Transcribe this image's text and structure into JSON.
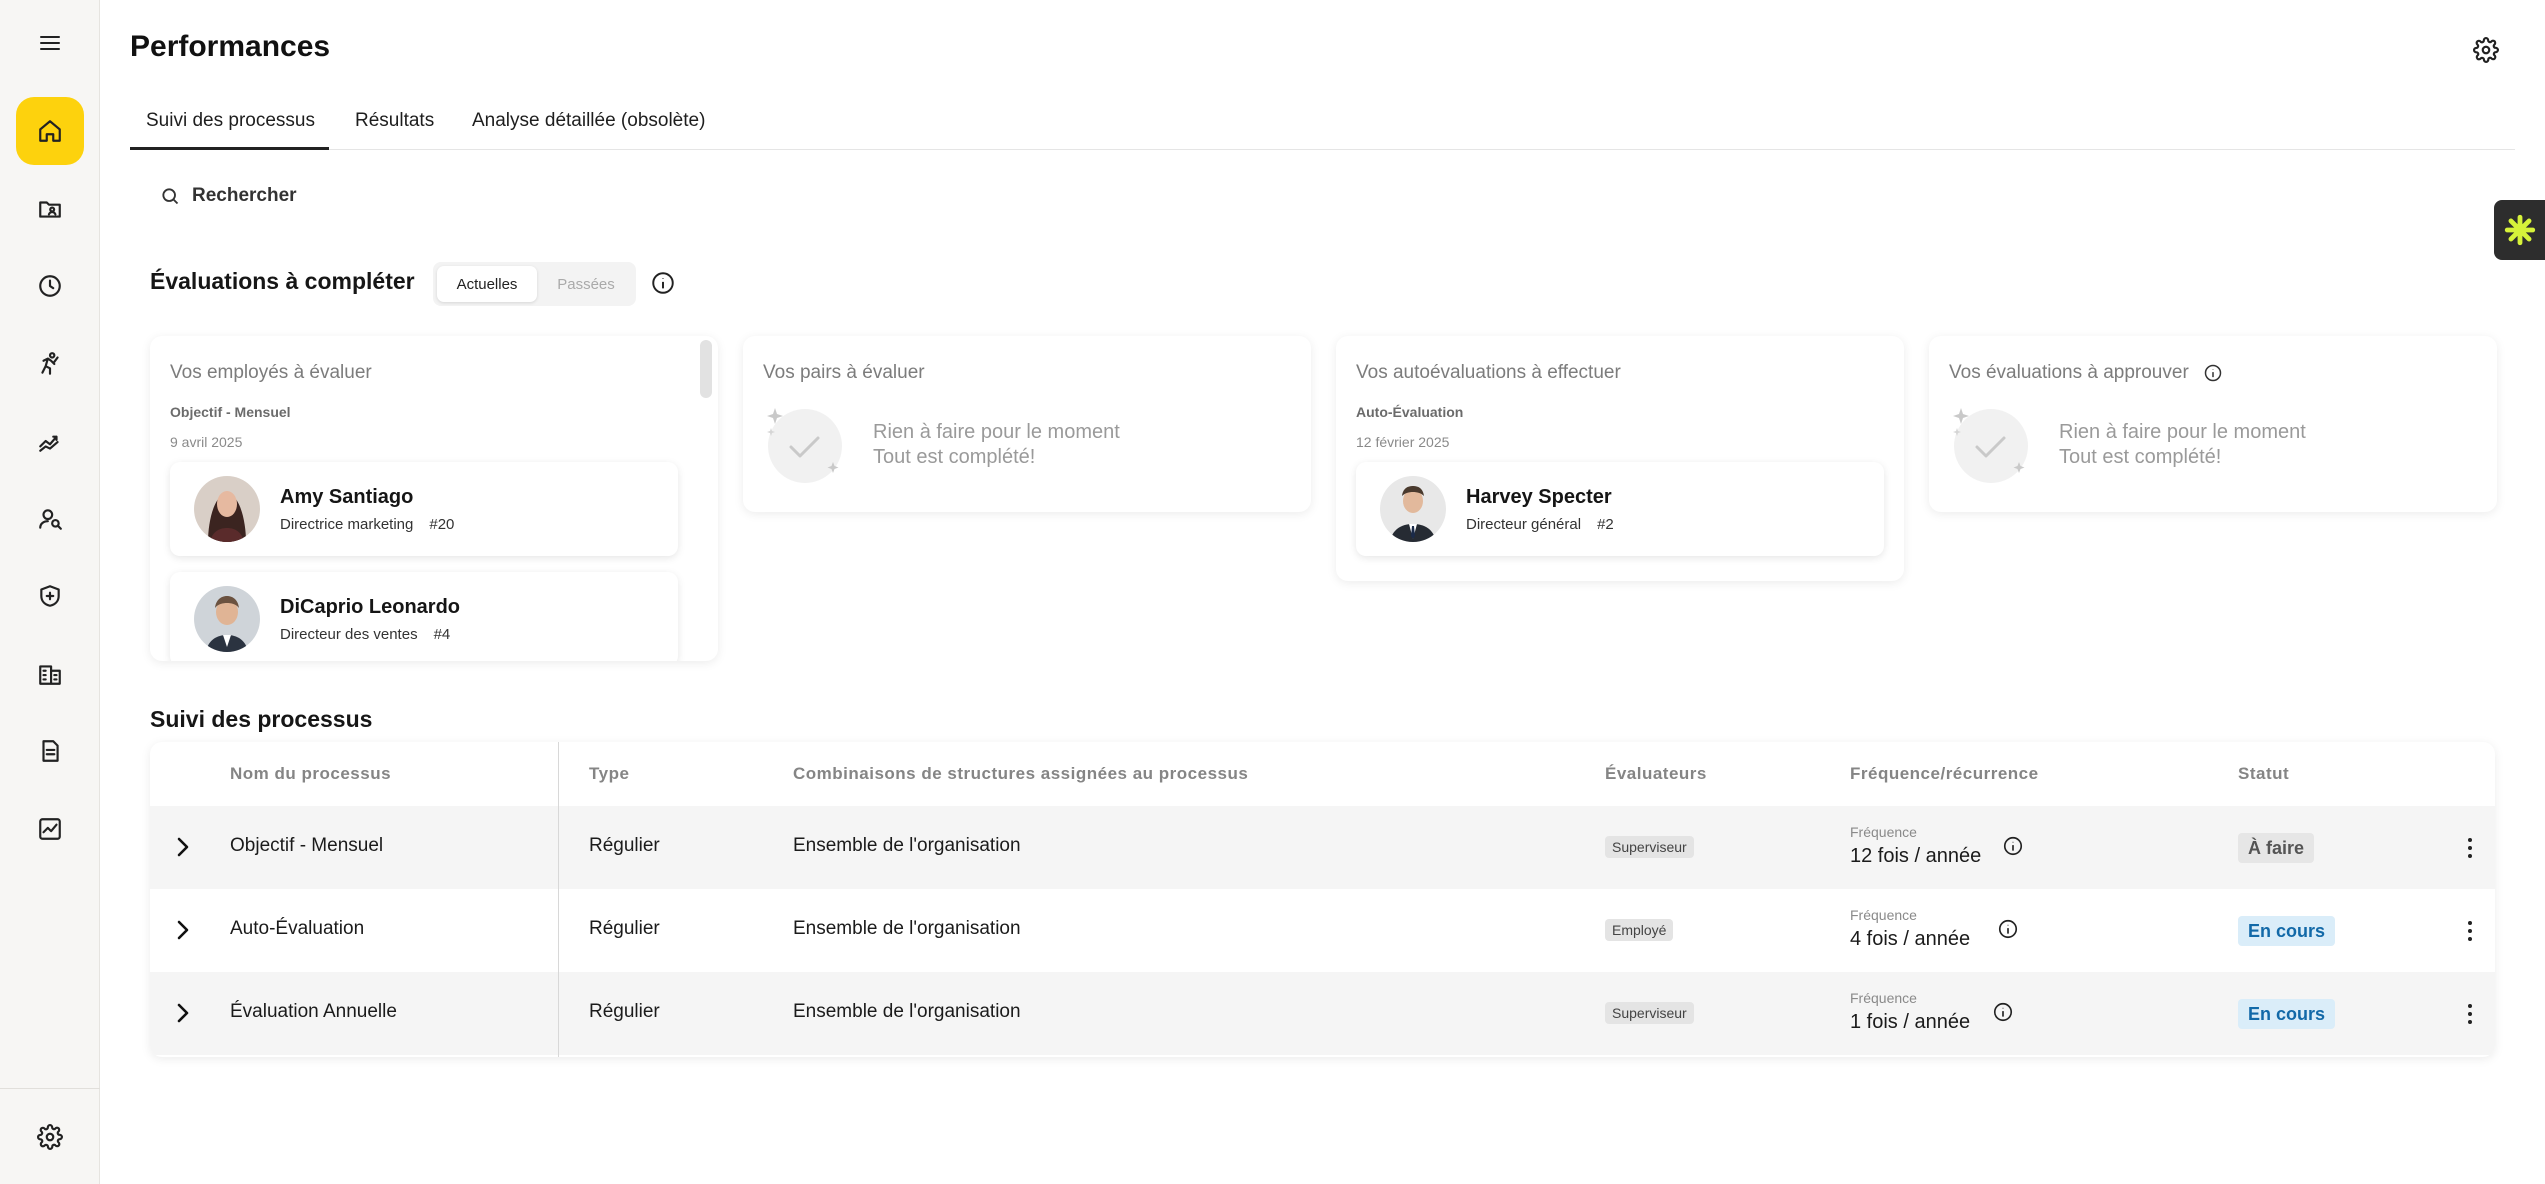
{
  "header": {
    "title": "Performances"
  },
  "tabs": [
    {
      "label": "Suivi des processus",
      "active": true
    },
    {
      "label": "Résultats",
      "active": false
    },
    {
      "label": "Analyse détaillée (obsolète)",
      "active": false
    }
  ],
  "search": {
    "label": "Rechercher"
  },
  "evaluations": {
    "title": "Évaluations à compléter",
    "toggle": {
      "current": "Actuelles",
      "past": "Passées"
    },
    "cards": {
      "employees": {
        "title": "Vos employés à évaluer",
        "process": "Objectif - Mensuel",
        "date": "9 avril 2025",
        "people": [
          {
            "name": "Amy Santiago",
            "role": "Directrice marketing",
            "id": "#20"
          },
          {
            "name": "DiCaprio Leonardo",
            "role": "Directeur des ventes",
            "id": "#4"
          }
        ]
      },
      "peers": {
        "title": "Vos pairs à évaluer",
        "empty_line1": "Rien à faire pour le moment",
        "empty_line2": "Tout est complété!"
      },
      "self": {
        "title": "Vos autoévaluations à effectuer",
        "process": "Auto-Évaluation",
        "date": "12 février 2025",
        "people": [
          {
            "name": "Harvey Specter",
            "role": "Directeur général",
            "id": "#2"
          }
        ]
      },
      "approve": {
        "title": "Vos évaluations à approuver",
        "empty_line1": "Rien à faire pour le moment",
        "empty_line2": "Tout est complété!"
      }
    }
  },
  "process_tracking": {
    "title": "Suivi des processus",
    "columns": {
      "name": "Nom du processus",
      "type": "Type",
      "structures": "Combinaisons de structures assignées au processus",
      "evaluators": "Évaluateurs",
      "frequency": "Fréquence/récurrence",
      "status": "Statut"
    },
    "rows": [
      {
        "name": "Objectif - Mensuel",
        "type": "Régulier",
        "structures": "Ensemble de l'organisation",
        "evaluator": "Superviseur",
        "freq_label": "Fréquence",
        "freq_value": "12 fois / année",
        "status": "À faire"
      },
      {
        "name": "Auto-Évaluation",
        "type": "Régulier",
        "structures": "Ensemble de l'organisation",
        "evaluator": "Employé",
        "freq_label": "Fréquence",
        "freq_value": "4 fois / année",
        "status": "En cours"
      },
      {
        "name": "Évaluation Annuelle",
        "type": "Régulier",
        "structures": "Ensemble de l'organisation",
        "evaluator": "Superviseur",
        "freq_label": "Fréquence",
        "freq_value": "1 fois / année",
        "status": "En cours"
      }
    ]
  },
  "sidebar": {
    "icons": [
      "menu-icon",
      "home-icon",
      "folder-user-icon",
      "clock-icon",
      "person-running-icon",
      "chart-trend-icon",
      "user-search-icon",
      "shield-plus-icon",
      "building-icon",
      "document-icon",
      "chart-box-icon",
      "gear-icon"
    ]
  },
  "colors": {
    "accent": "#fdd20d",
    "status_progress_bg": "#daedf9",
    "status_progress_text": "#1269a8",
    "status_todo_bg": "#e6e6e6"
  }
}
